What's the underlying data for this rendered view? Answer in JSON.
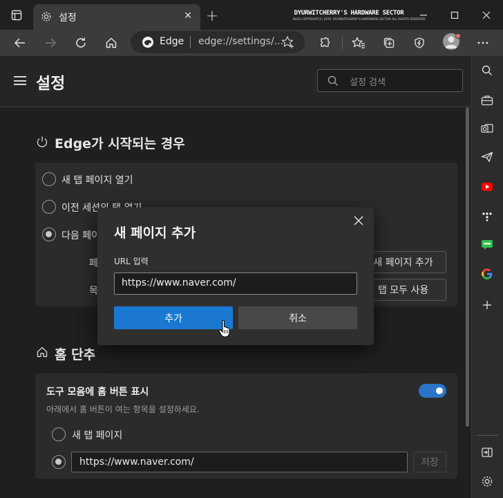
{
  "window": {
    "tab_title": "설정",
    "watermark_title": "DYURWITCHERRY'S HARDWARE SECTOR",
    "watermark_sub": "BLOG COPYRIGHT(C) 2015. DYURWITCHERRY'S HARDWARE SECTOR ALL RIGHTS RESERVED."
  },
  "address_bar": {
    "site_label": "Edge",
    "url": "edge://settings/..."
  },
  "settings": {
    "page_title": "설정",
    "search_placeholder": "설정 검색",
    "startup": {
      "title": "Edge가 시작되는 경우",
      "options": [
        {
          "label": "새 탭 페이지 열기",
          "checked": false
        },
        {
          "label": "이전 세션의 탭 열기",
          "checked": false
        },
        {
          "label": "다음 페이지 열기",
          "checked": true
        }
      ],
      "row1_label": "페",
      "row2_label": "목",
      "add_page_button": "새 페이지 추가",
      "use_all_tabs_button": "열린 탭 모두 사용"
    },
    "home": {
      "title": "홈 단추",
      "toggle_label": "도구 모음에 홈 버튼 표시",
      "toggle_on": true,
      "description": "아래에서 홈 버튼이 여는 항목을 설정하세요.",
      "option_newtab": "새 탭 페이지",
      "url_value": "https://www.naver.com/",
      "save_button": "저장"
    }
  },
  "dialog": {
    "title": "새 페이지 추가",
    "url_label": "URL 입력",
    "url_value": "https://www.naver.com/",
    "add_button": "추가",
    "cancel_button": "취소"
  },
  "colors": {
    "accent": "#1a78d0",
    "toggle": "#2a74c9",
    "background": "#1f1f1f",
    "card": "#2b2b2b"
  },
  "sidebar_icons": [
    "search-icon",
    "briefcase-icon",
    "outlook-icon",
    "send-icon",
    "youtube-icon",
    "dots-app-icon",
    "line-app-icon",
    "google-icon",
    "add-icon",
    "exit-sidebar-icon",
    "settings-icon"
  ]
}
